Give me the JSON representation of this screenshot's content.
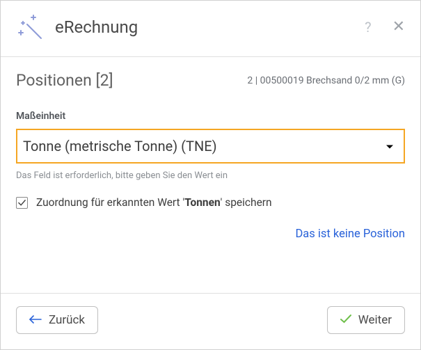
{
  "header": {
    "title": "eRechnung"
  },
  "subheader": {
    "section_title": "Positionen [2]",
    "position_info": "2 | 00500019 Brechsand 0/2 mm (G)"
  },
  "form": {
    "field_label": "Maßeinheit",
    "select_value": "Tonne (metrische Tonne) (TNE)",
    "help_text": "Das Feld ist erforderlich, bitte geben Sie den Wert ein",
    "checkbox": {
      "checked": true,
      "label_pre": "Zuordnung für erkannten Wert '",
      "label_bold": "Tonnen",
      "label_post": "' speichern"
    },
    "not_position_link": "Das ist keine Position"
  },
  "footer": {
    "back_label": "Zurück",
    "next_label": "Weiter"
  }
}
